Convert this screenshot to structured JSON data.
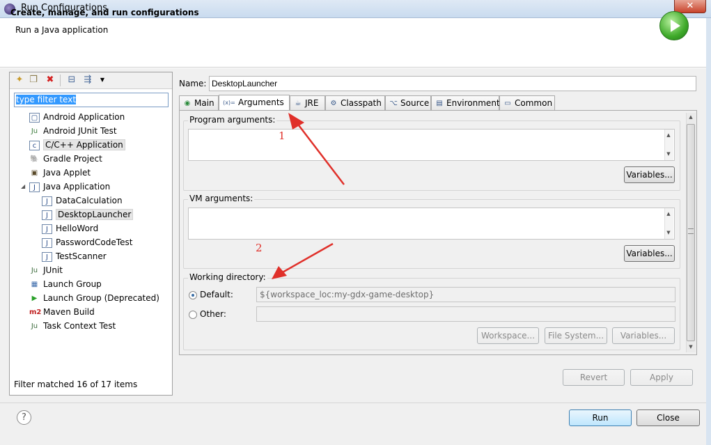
{
  "window": {
    "title": "Run Configurations",
    "close_label": "✕"
  },
  "header": {
    "title": "Create, manage, and run configurations",
    "subtitle": "Run a Java application"
  },
  "left": {
    "filter_placeholder": "type filter text",
    "tree": [
      {
        "label": "Android Application",
        "icon": "android-app-icon",
        "glyph": "▢"
      },
      {
        "label": "Android JUnit Test",
        "icon": "android-junit-icon",
        "glyph": "Ju"
      },
      {
        "label": "C/C++ Application",
        "icon": "c-app-icon",
        "glyph": "c",
        "selected": true
      },
      {
        "label": "Gradle Project",
        "icon": "gradle-icon",
        "glyph": "🐘"
      },
      {
        "label": "Java Applet",
        "icon": "java-applet-icon",
        "glyph": "▣"
      },
      {
        "label": "Java Application",
        "icon": "java-app-icon",
        "glyph": "J",
        "expanded": true
      },
      {
        "label": "DataCalculation",
        "icon": "java-config-icon",
        "glyph": "J",
        "child": true
      },
      {
        "label": "DesktopLauncher",
        "icon": "java-config-icon",
        "glyph": "J",
        "child": true,
        "selected": true
      },
      {
        "label": "HelloWord",
        "icon": "java-config-icon",
        "glyph": "J",
        "child": true
      },
      {
        "label": "PasswordCodeTest",
        "icon": "java-config-icon",
        "glyph": "J",
        "child": true
      },
      {
        "label": "TestScanner",
        "icon": "java-config-icon",
        "glyph": "J",
        "child": true
      },
      {
        "label": "JUnit",
        "icon": "junit-icon",
        "glyph": "Ju"
      },
      {
        "label": "Launch Group",
        "icon": "launch-group-icon",
        "glyph": "▦"
      },
      {
        "label": "Launch Group (Deprecated)",
        "icon": "launch-group-deprecated-icon",
        "glyph": "▶"
      },
      {
        "label": "Maven Build",
        "icon": "maven-icon",
        "glyph": "m2"
      },
      {
        "label": "Task Context Test",
        "icon": "task-context-icon",
        "glyph": "Ju"
      }
    ],
    "filter_status": "Filter matched 16 of 17 items"
  },
  "config": {
    "name_label": "Name:",
    "name_value": "DesktopLauncher",
    "tabs": [
      {
        "label": "Main",
        "icon": "main-tab-icon",
        "glyph": "◉"
      },
      {
        "label": "Arguments",
        "icon": "arguments-tab-icon",
        "glyph": "(x)="
      },
      {
        "label": "JRE",
        "icon": "jre-tab-icon",
        "glyph": "☕"
      },
      {
        "label": "Classpath",
        "icon": "classpath-tab-icon",
        "glyph": "⚙"
      },
      {
        "label": "Source",
        "icon": "source-tab-icon",
        "glyph": "⌥"
      },
      {
        "label": "Environment",
        "icon": "environment-tab-icon",
        "glyph": "▤"
      },
      {
        "label": "Common",
        "icon": "common-tab-icon",
        "glyph": "▭"
      }
    ],
    "program_args_label": "Program arguments:",
    "program_args_value": "",
    "vm_args_label": "VM arguments:",
    "vm_args_value": "",
    "variables_label": "Variables...",
    "working_dir_label": "Working directory:",
    "default_label": "Default:",
    "default_value": "${workspace_loc:my-gdx-game-desktop}",
    "other_label": "Other:",
    "other_value": "",
    "workspace_label": "Workspace...",
    "filesystem_label": "File System...",
    "revert_label": "Revert",
    "apply_label": "Apply"
  },
  "annotations": {
    "one": "1",
    "two": "2",
    "color": "#e0302a"
  },
  "footer": {
    "help_label": "?",
    "run_label": "Run",
    "close_label": "Close"
  }
}
